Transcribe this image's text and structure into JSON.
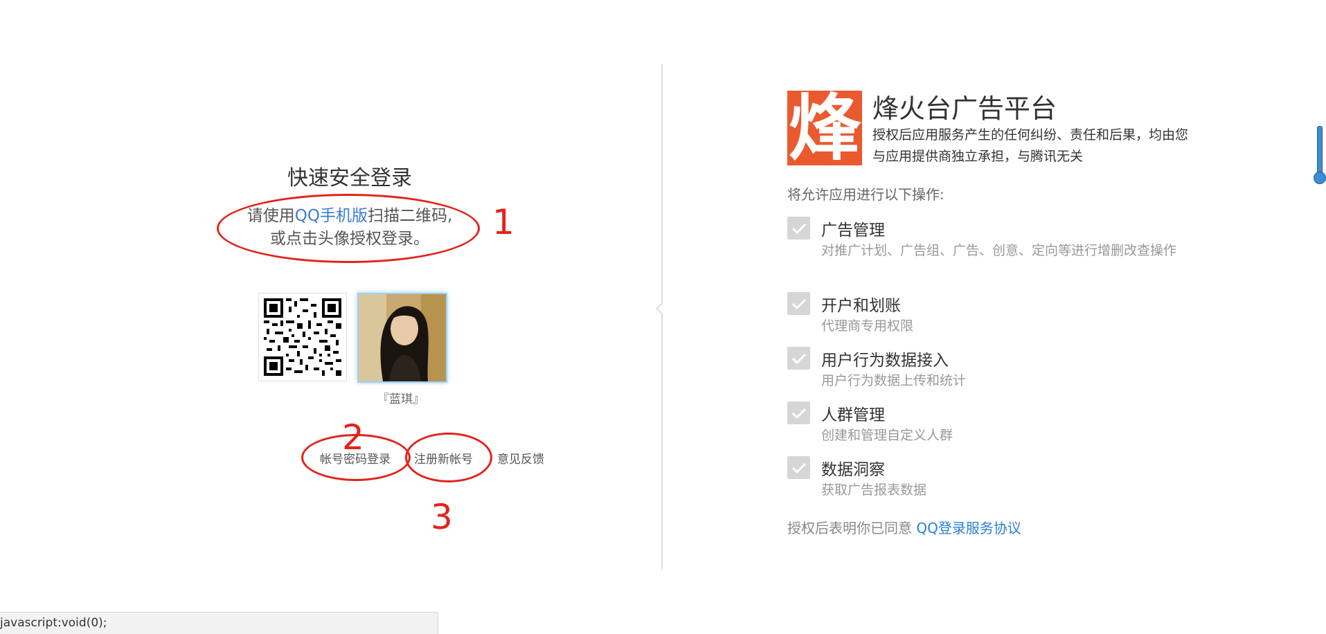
{
  "login": {
    "title": "快速安全登录",
    "desc_prefix": "请使用",
    "desc_link": "QQ手机版",
    "desc_suffix": "扫描二维码,",
    "desc_line2": "或点击头像授权登录。",
    "nickname": "『蓝琪』",
    "links": {
      "password_login": "帐号密码登录",
      "register": "注册新帐号",
      "feedback": "意见反馈"
    }
  },
  "annotations": {
    "one": "1",
    "two": "2",
    "three": "3",
    "color": "#e2231a"
  },
  "app": {
    "logo_char": "烽",
    "logo_color": "#ea5a2e",
    "name": "烽火台广告平台",
    "disclaimer": "授权后应用服务产生的任何纠纷、责任和后果，均由您与应用提供商独立承担，与腾讯无关"
  },
  "permissions": {
    "intro": "将允许应用进行以下操作:",
    "items": [
      {
        "title": "广告管理",
        "desc": "对推广计划、广告组、广告、创意、定向等进行增删改查操作"
      },
      {
        "title": "开户和划账",
        "desc": "代理商专用权限"
      },
      {
        "title": "用户行为数据接入",
        "desc": "用户行为数据上传和统计"
      },
      {
        "title": "人群管理",
        "desc": "创建和管理自定义人群"
      },
      {
        "title": "数据洞察",
        "desc": "获取广告报表数据"
      }
    ]
  },
  "agreement": {
    "prefix": "授权后表明你已同意 ",
    "link": "QQ登录服务协议"
  },
  "status_bar": {
    "text": "javascript:void(0);"
  },
  "icons": {
    "qr": "qr-code-icon",
    "check": "check-icon",
    "avatar": "avatar-image"
  }
}
